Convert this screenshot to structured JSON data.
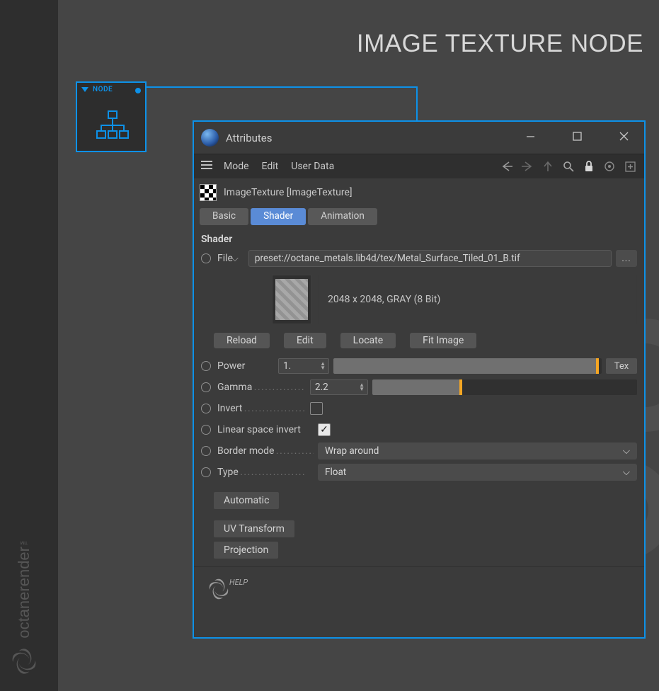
{
  "page_title": "IMAGE TEXTURE NODE",
  "node_box": {
    "label": "NODE"
  },
  "panel": {
    "title": "Attributes",
    "menu": {
      "mode": "Mode",
      "edit": "Edit",
      "user_data": "User Data"
    },
    "node_line": "ImageTexture [ImageTexture]",
    "tabs": {
      "basic": "Basic",
      "shader": "Shader",
      "animation": "Animation"
    },
    "section": "Shader",
    "file": {
      "label": "File",
      "path": "preset://octane_metals.lib4d/tex/Metal_Surface_Tiled_01_B.tif",
      "info": "2048 x 2048, GRAY (8 Bit)"
    },
    "btns": {
      "reload": "Reload",
      "edit": "Edit",
      "locate": "Locate",
      "fit": "Fit Image"
    },
    "power": {
      "label": "Power",
      "value": "1.",
      "tex": "Tex",
      "fill_pct": 98
    },
    "gamma": {
      "label": "Gamma",
      "value": "2.2",
      "fill_pct": 33
    },
    "invert": {
      "label": "Invert",
      "checked": false
    },
    "linear": {
      "label": "Linear space invert",
      "checked": true
    },
    "bordermode": {
      "label": "Border mode",
      "value": "Wrap around"
    },
    "type": {
      "label": "Type",
      "value": "Float"
    },
    "auto": "Automatic",
    "uv": "UV Transform",
    "proj": "Projection",
    "help": "HELP"
  },
  "brand": {
    "name": "octanerender",
    "tm": "™"
  }
}
